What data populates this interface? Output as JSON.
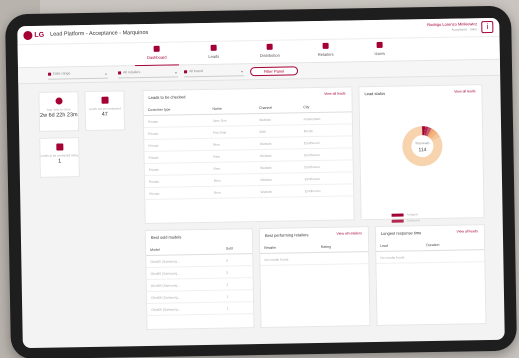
{
  "app": {
    "logo_text": "LG",
    "title": "Lead Platform - Acceptance - Marquinos",
    "user_name": "Rodrigo Lorenzo Minkiewicz",
    "user_sub": "Acceptance · Sales",
    "user_icon": "user-icon"
  },
  "nav": {
    "tabs": [
      {
        "label": "Dashboard",
        "icon": "dashboard-icon"
      },
      {
        "label": "Leads",
        "icon": "leads-icon"
      },
      {
        "label": "Distribution",
        "icon": "distribution-icon"
      },
      {
        "label": "Retailers",
        "icon": "retailers-icon"
      },
      {
        "label": "Users",
        "icon": "users-icon"
      }
    ]
  },
  "filters": {
    "date_range": "Date range",
    "all_retailers": "All retailers",
    "all_brand": "All brand",
    "apply_label": "Filter Panel"
  },
  "stats": [
    {
      "title": "Avg. time to close",
      "value": "2w 6d 22h 23m"
    },
    {
      "title": "Leads not yet contacted",
      "value": "47"
    },
    {
      "title": "Leads to be contacted today",
      "value": "1"
    }
  ],
  "leads_table": {
    "title": "Leads to be checked",
    "link": "View all leads",
    "headers": [
      "Customer type",
      "Name",
      "Channel",
      "City"
    ],
    "rows": [
      [
        "Private",
        "Jane Doe",
        "Website",
        "Amsterdam"
      ],
      [
        "Private",
        "Piet Smit",
        "B2B",
        "Breda"
      ],
      [
        "Private",
        "Rien",
        "Website",
        "Eindhoven"
      ],
      [
        "Private",
        "Rien",
        "Website",
        "Eindhoven"
      ],
      [
        "Private",
        "Rien",
        "Website",
        "Eindhoven"
      ],
      [
        "Private",
        "Rien",
        "Website",
        "Eindhoven"
      ],
      [
        "Private",
        "Rien",
        "Website",
        "Eindhoven"
      ]
    ]
  },
  "lead_status": {
    "title": "Lead status",
    "link": "View all leads",
    "center_label": "Total leads",
    "center_value": "114",
    "legend": [
      "Assigned",
      "Contacted",
      "Pending",
      "Appointment",
      "Sold",
      "Not sold",
      "Cancelled"
    ],
    "colors": [
      "#a50034",
      "#b22a4e",
      "#c4566e",
      "#f0a46a",
      "#f3b47e",
      "#f5c497",
      "#f7d3ae"
    ],
    "values": [
      3,
      3,
      3,
      3,
      4,
      4,
      94
    ]
  },
  "best_sold": {
    "title": "Best sold models",
    "headers": [
      "Model",
      "Sold"
    ],
    "rows": [
      [
        "Oled65 (Samsung...",
        "4"
      ],
      [
        "Oled65 (Samsung...",
        "3"
      ],
      [
        "Oled55 (Samsung...",
        "2"
      ],
      [
        "Oled65 (Samsung...",
        "1"
      ],
      [
        "Oled65 (Samsung...",
        "1"
      ]
    ]
  },
  "best_retailers": {
    "title": "Best performing retailers",
    "link": "View all retailers",
    "headers": [
      "Retailer",
      "Rating"
    ],
    "empty": "No results found"
  },
  "longest_response": {
    "title": "Longest response time",
    "link": "View all leads",
    "headers": [
      "Lead",
      "Duration"
    ],
    "empty": "No results found"
  }
}
